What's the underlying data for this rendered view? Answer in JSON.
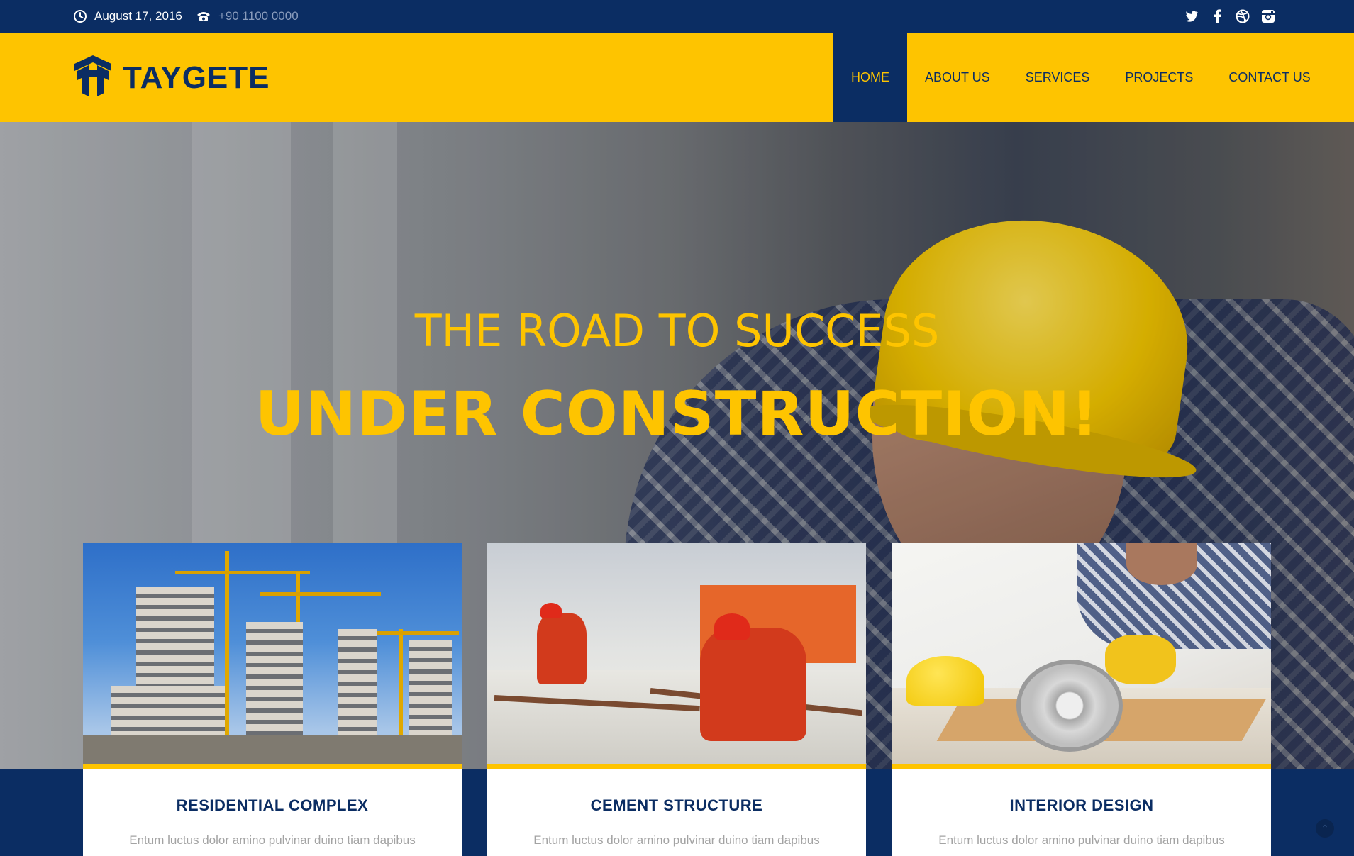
{
  "topbar": {
    "date": "August 17, 2016",
    "phone": "+90 1100 0000",
    "social_icons": [
      "twitter-icon",
      "facebook-icon",
      "dribbble-icon",
      "instagram-icon"
    ]
  },
  "brand": {
    "name": "TAYGETE"
  },
  "nav": {
    "items": [
      {
        "label": "HOME",
        "active": true
      },
      {
        "label": "ABOUT US",
        "active": false
      },
      {
        "label": "SERVICES",
        "active": false
      },
      {
        "label": "PROJECTS",
        "active": false
      },
      {
        "label": "CONTACT US",
        "active": false
      }
    ]
  },
  "hero": {
    "subtitle": "THE ROAD TO SUCCESS",
    "title": "UNDER CONSTRUCTION!"
  },
  "cards": [
    {
      "title": "RESIDENTIAL COMPLEX",
      "text": "Entum luctus dolor amino pulvinar duino tiam dapibus"
    },
    {
      "title": "CEMENT STRUCTURE",
      "text": "Entum luctus dolor amino pulvinar duino tiam dapibus"
    },
    {
      "title": "INTERIOR DESIGN",
      "text": "Entum luctus dolor amino pulvinar duino tiam dapibus"
    }
  ],
  "colors": {
    "navy": "#0b2d63",
    "yellow": "#fec400",
    "muted_text": "#a3a3a3"
  }
}
